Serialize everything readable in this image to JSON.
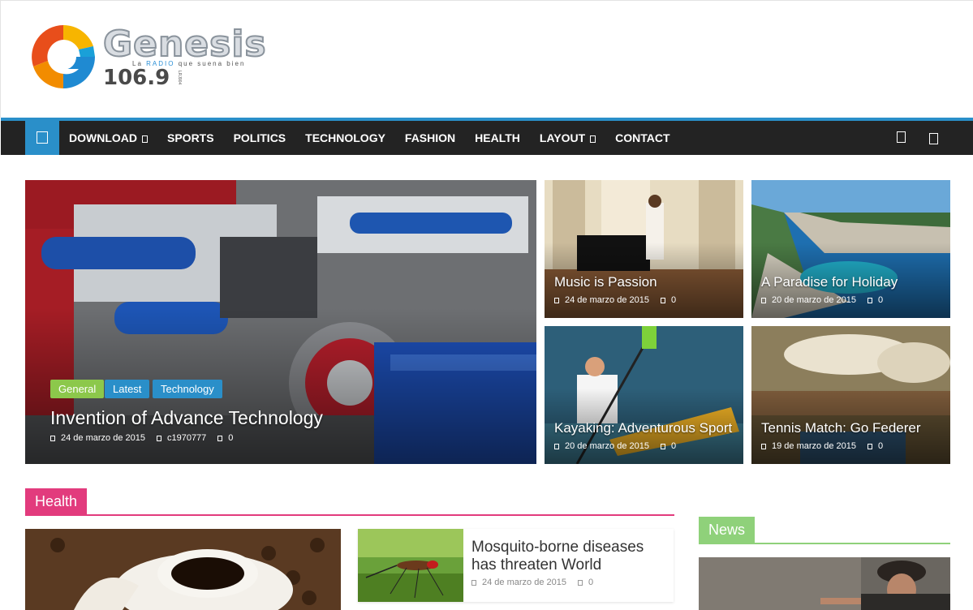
{
  "header": {
    "logo_word": "Genesis",
    "logo_tagline_pre": "La ",
    "logo_tagline_radio": "RADIO",
    "logo_tagline_post": " que suena bien",
    "logo_frequency": "106.9",
    "logo_callsign": "LRJ904"
  },
  "nav": {
    "accent_color": "#2a8fc9",
    "items": [
      {
        "label": "DOWNLOAD",
        "dropdown": true
      },
      {
        "label": "SPORTS",
        "dropdown": false
      },
      {
        "label": "POLITICS",
        "dropdown": false
      },
      {
        "label": "TECHNOLOGY",
        "dropdown": false
      },
      {
        "label": "FASHION",
        "dropdown": false
      },
      {
        "label": "HEALTH",
        "dropdown": false
      },
      {
        "label": "LAYOUT",
        "dropdown": true
      },
      {
        "label": "CONTACT",
        "dropdown": false
      }
    ],
    "home_icon": "home-icon",
    "random_icon": "random-post-icon",
    "search_icon": "search-icon"
  },
  "featured": {
    "main": {
      "categories": [
        {
          "label": "General",
          "color": "#8cc84b"
        },
        {
          "label": "Latest",
          "color": "#2a8fc9"
        },
        {
          "label": "Technology",
          "color": "#2a8fc9"
        }
      ],
      "title": "Invention of Advance Technology",
      "date": "24 de marzo de 2015",
      "author": "c1970777",
      "comments": "0"
    },
    "tiles": [
      {
        "title": "Music is Passion",
        "date": "24 de marzo de 2015",
        "comments": "0"
      },
      {
        "title": "A Paradise for Holiday",
        "date": "20 de marzo de 2015",
        "comments": "0"
      },
      {
        "title": "Kayaking: Adventurous Sport",
        "date": "20 de marzo de 2015",
        "comments": "0"
      },
      {
        "title": "Tennis Match: Go Federer",
        "date": "19 de marzo de 2015",
        "comments": "0"
      }
    ]
  },
  "health": {
    "label": "Health",
    "color": "#e23b7d",
    "article": {
      "title": "Mosquito-borne diseases has threaten World",
      "date": "24 de marzo de 2015",
      "comments": "0"
    }
  },
  "news": {
    "label": "News",
    "color": "#8fd17a"
  }
}
